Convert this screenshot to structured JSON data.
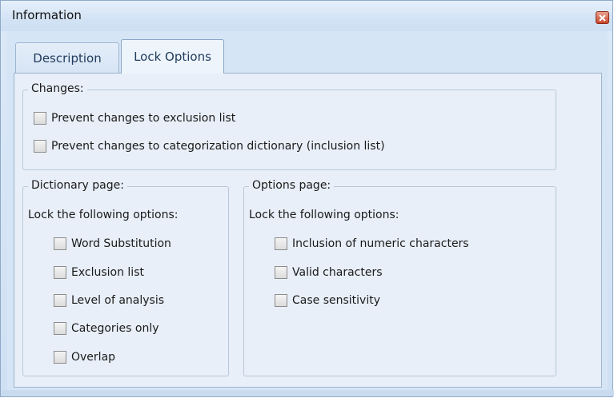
{
  "window": {
    "title": "Information"
  },
  "tabs": [
    {
      "label": "Description",
      "active": false
    },
    {
      "label": "Lock Options",
      "active": true
    }
  ],
  "changes": {
    "legend": "Changes:",
    "items": [
      {
        "label": "Prevent changes to exclusion list",
        "checked": false
      },
      {
        "label": "Prevent changes to categorization dictionary (inclusion list)",
        "checked": false
      }
    ]
  },
  "dictionary_page": {
    "legend": "Dictionary page:",
    "intro": "Lock the following options:",
    "items": [
      {
        "label": "Word Substitution",
        "checked": false
      },
      {
        "label": "Exclusion list",
        "checked": false
      },
      {
        "label": "Level of analysis",
        "checked": false
      },
      {
        "label": "Categories only",
        "checked": false
      },
      {
        "label": "Overlap",
        "checked": false
      }
    ]
  },
  "options_page": {
    "legend": "Options page:",
    "intro": "Lock the following options:",
    "items": [
      {
        "label": "Inclusion of numeric characters",
        "checked": false
      },
      {
        "label": "Valid characters",
        "checked": false
      },
      {
        "label": "Case sensitivity",
        "checked": false
      }
    ]
  },
  "icons": {
    "close": "close-icon"
  },
  "colors": {
    "title_bar": "#d3e3f5",
    "panel_bg": "#e8eff8",
    "close_button": "#c8452c"
  }
}
